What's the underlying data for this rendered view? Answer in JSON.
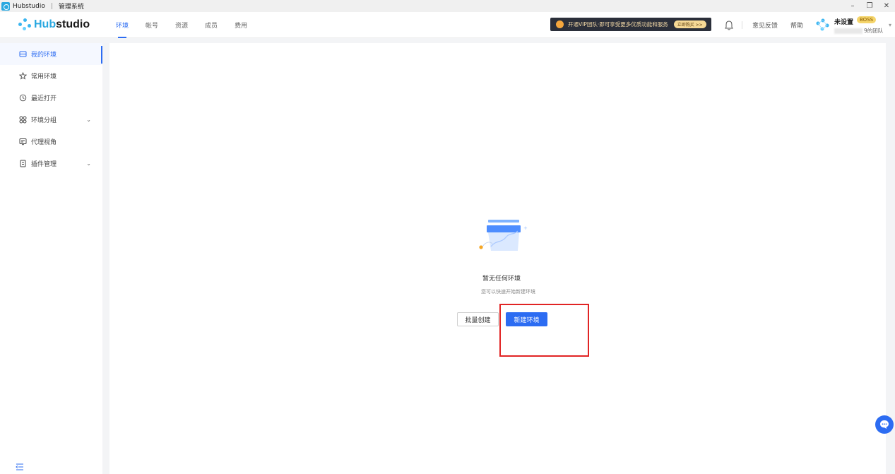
{
  "window": {
    "app_name": "Hubstudio",
    "separator": "|",
    "subtitle": "管理系统",
    "controls": [
      "–",
      "❐",
      "✕"
    ]
  },
  "brand": {
    "logo_prefix": "Hub",
    "logo_suffix": "studio"
  },
  "nav": {
    "tabs": [
      {
        "label": "环境",
        "active": true
      },
      {
        "label": "帐号",
        "active": false
      },
      {
        "label": "资源",
        "active": false
      },
      {
        "label": "成员",
        "active": false
      },
      {
        "label": "费用",
        "active": false
      }
    ]
  },
  "vip_banner": {
    "text": "开通VIP团队·即可享受更多优质功能和服务",
    "button": "立即购买 >>"
  },
  "header_links": {
    "feedback": "意见反馈",
    "help": "帮助"
  },
  "user": {
    "name": "未设置",
    "role_badge": "BOSS",
    "team_suffix": "9的团队"
  },
  "sidebar": {
    "items": [
      {
        "label": "我的环境",
        "icon": "box-icon",
        "active": true
      },
      {
        "label": "常用环境",
        "icon": "star-icon",
        "active": false
      },
      {
        "label": "最近打开",
        "icon": "clock-icon",
        "active": false
      },
      {
        "label": "环境分组",
        "icon": "group-icon",
        "active": false,
        "expandable": true
      },
      {
        "label": "代理视角",
        "icon": "proxy-view-icon",
        "active": false
      },
      {
        "label": "插件管理",
        "icon": "plugin-icon",
        "active": false,
        "expandable": true
      }
    ]
  },
  "empty_state": {
    "title": "暂无任何环境",
    "subtitle": "您可以快速开始新建环境",
    "batch_button": "批量创建",
    "new_button": "新建环境"
  },
  "colors": {
    "accent": "#2c6cf2",
    "highlight_box": "#e12424",
    "vip_bg": "#2b2f3a"
  }
}
